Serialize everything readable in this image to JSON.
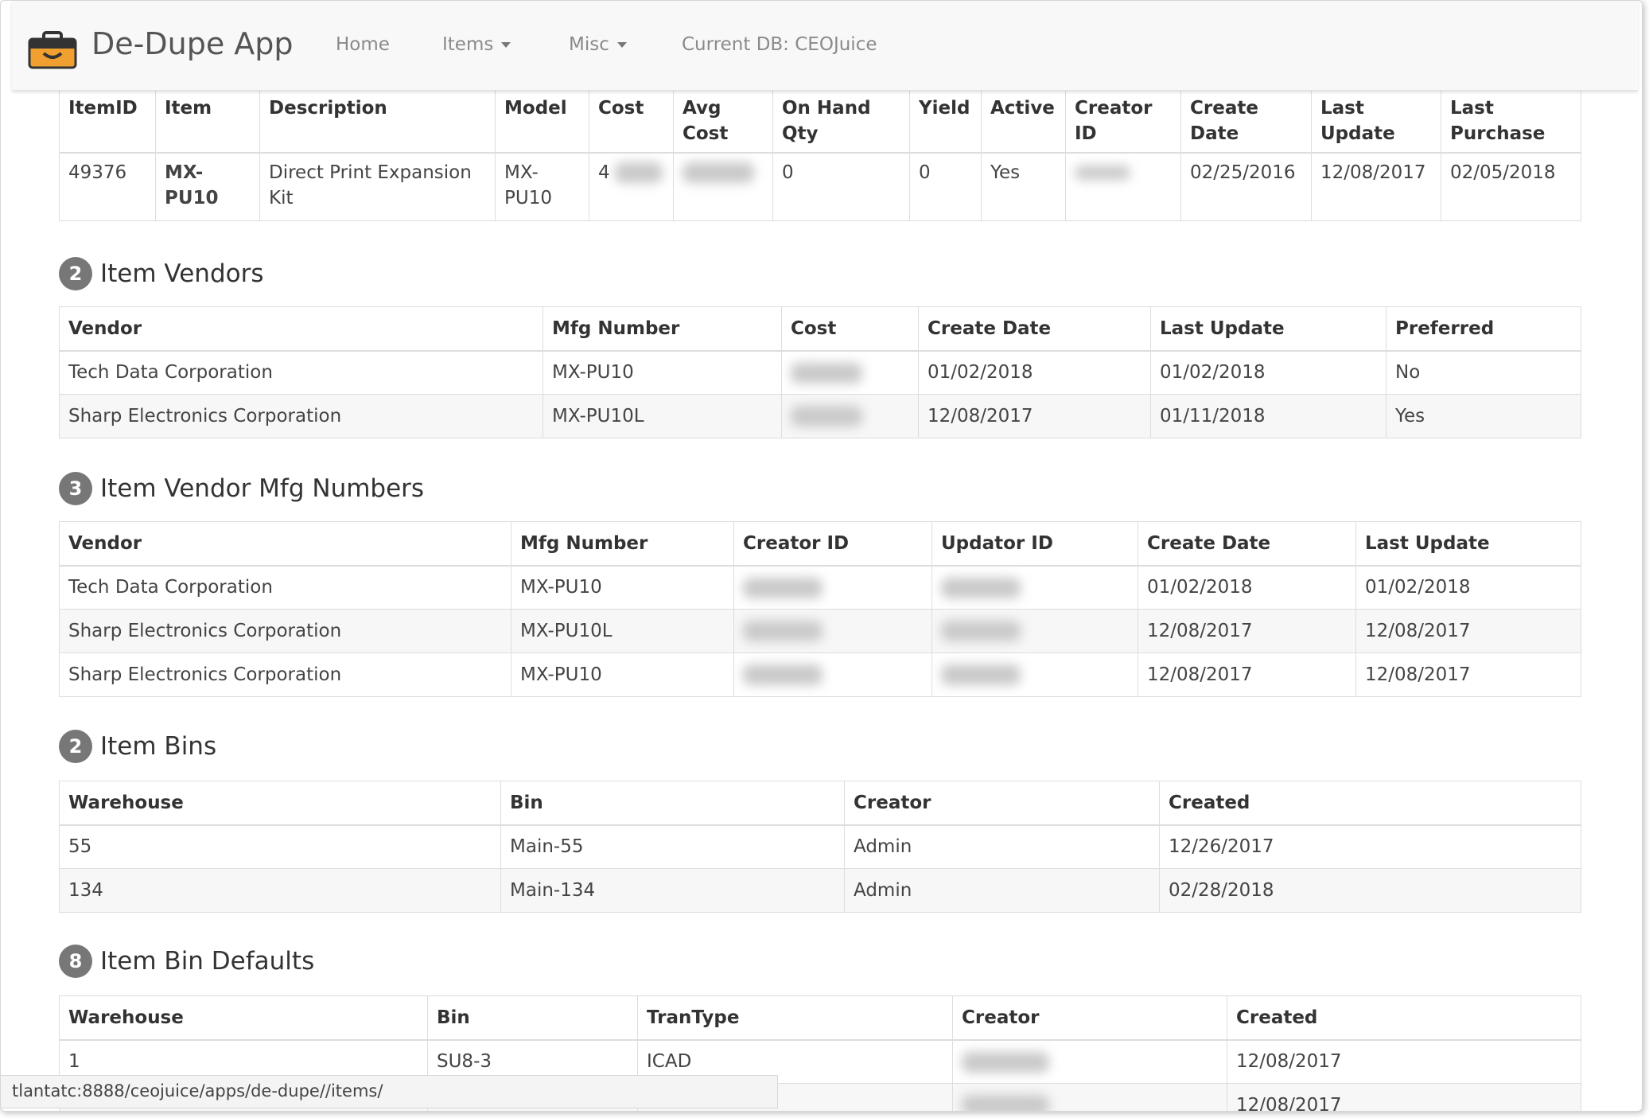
{
  "navbar": {
    "brand": "De-Dupe App",
    "home": "Home",
    "items": "Items",
    "misc": "Misc",
    "current_db": "Current DB: CEOJuice"
  },
  "item_table": {
    "headers": [
      "ItemID",
      "Item",
      "Description",
      "Model",
      "Cost",
      "Avg Cost",
      "On Hand Qty",
      "Yield",
      "Active",
      "Creator ID",
      "Create Date",
      "Last Update",
      "Last Purchase"
    ],
    "row": {
      "item_id": "49376",
      "item": "MX-PU10",
      "description": "Direct Print Expansion Kit",
      "model": "MX-PU10",
      "cost": "4",
      "avg_cost": "",
      "on_hand_qty": "0",
      "yield": "0",
      "active": "Yes",
      "creator_id": "",
      "create_date": "02/25/2016",
      "last_update": "12/08/2017",
      "last_purchase": "02/05/2018"
    }
  },
  "vendors": {
    "count": "2",
    "title": "Item Vendors",
    "headers": [
      "Vendor",
      "Mfg Number",
      "Cost",
      "Create Date",
      "Last Update",
      "Preferred"
    ],
    "rows": [
      {
        "vendor": "Tech Data Corporation",
        "mfg": "MX-PU10",
        "create": "01/02/2018",
        "update": "01/02/2018",
        "preferred": "No"
      },
      {
        "vendor": "Sharp Electronics Corporation",
        "mfg": "MX-PU10L",
        "create": "12/08/2017",
        "update": "01/11/2018",
        "preferred": "Yes"
      }
    ]
  },
  "mfg_numbers": {
    "count": "3",
    "title": "Item Vendor Mfg Numbers",
    "headers": [
      "Vendor",
      "Mfg Number",
      "Creator ID",
      "Updator ID",
      "Create Date",
      "Last Update"
    ],
    "rows": [
      {
        "vendor": "Tech Data Corporation",
        "mfg": "MX-PU10",
        "create": "01/02/2018",
        "update": "01/02/2018"
      },
      {
        "vendor": "Sharp Electronics Corporation",
        "mfg": "MX-PU10L",
        "create": "12/08/2017",
        "update": "12/08/2017"
      },
      {
        "vendor": "Sharp Electronics Corporation",
        "mfg": "MX-PU10",
        "create": "12/08/2017",
        "update": "12/08/2017"
      }
    ]
  },
  "bins": {
    "count": "2",
    "title": "Item Bins",
    "headers": [
      "Warehouse",
      "Bin",
      "Creator",
      "Created"
    ],
    "rows": [
      {
        "warehouse": "55",
        "bin": "Main-55",
        "creator": "Admin",
        "created": "12/26/2017"
      },
      {
        "warehouse": "134",
        "bin": "Main-134",
        "creator": "Admin",
        "created": "02/28/2018"
      }
    ]
  },
  "bin_defaults": {
    "count": "8",
    "title": "Item Bin Defaults",
    "headers": [
      "Warehouse",
      "Bin",
      "TranType",
      "Creator",
      "Created"
    ],
    "rows": [
      {
        "warehouse": "1",
        "bin": "SU8-3",
        "trantype": "ICAD",
        "created": "12/08/2017"
      },
      {
        "warehouse": "",
        "bin": "",
        "trantype": "",
        "created": "12/08/2017"
      }
    ]
  },
  "statusbar": {
    "url": "tlantatc:8888/ceojuice/apps/de-dupe//items/"
  },
  "icons": {
    "brand": "briefcase-icon",
    "items_menu": "caret-down-icon",
    "misc_menu": "caret-down-icon"
  },
  "colors": {
    "brand_icon": "#f0a030",
    "badge": "#777777",
    "navbar_bg": "#f8f8f8"
  }
}
